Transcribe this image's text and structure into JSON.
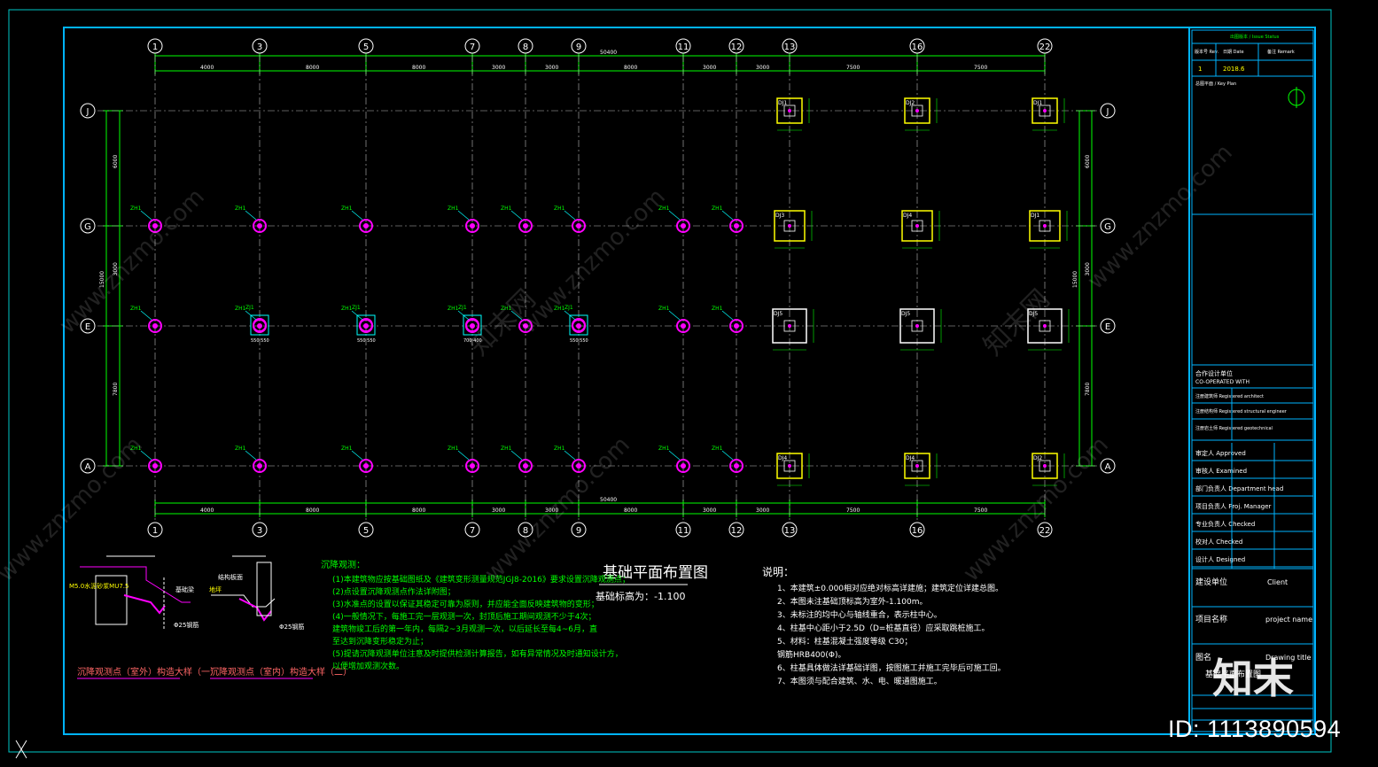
{
  "grid": {
    "vertical": [
      "1",
      "3",
      "5",
      "7",
      "8",
      "9",
      "11",
      "12",
      "13",
      "16",
      "22"
    ],
    "horizontal": [
      "J",
      "G",
      "E",
      "A"
    ]
  },
  "dimensions": {
    "top_spans": [
      "4000",
      "8000",
      "8000",
      "3000",
      "3000",
      "8000",
      "3000",
      "3000",
      "7500",
      "7500"
    ],
    "overall": "50400",
    "left_spans": [
      "6000",
      "3000",
      "7800"
    ],
    "left_total": "15000",
    "right_spans": [
      "6000",
      "3000",
      "7800"
    ],
    "right_total": "15000"
  },
  "piles": {
    "label": "ZH1"
  },
  "column_footings": {
    "labels": [
      "DJ1",
      "DJ2",
      "DJ1",
      "DJ3",
      "DJ4",
      "DJ1",
      "DJ5",
      "DJ5",
      "DJ5",
      "DJ4",
      "DJ4",
      "DJ2"
    ],
    "small_label": "ZJ1",
    "small_dims": [
      "550 550",
      "550 550",
      "700 400",
      "550 550"
    ]
  },
  "plan": {
    "title": "基础平面布置图",
    "subtitle": "基础标高为：-1.100"
  },
  "settlement": {
    "heading": "沉降观测：",
    "lines": [
      "(1)本建筑物应按基础图纸及《建筑变形测量规范JGJ8-2016》要求设置沉降观测点；",
      "(2)点设置沉降观测点作法详附图；",
      "(3)水准点的设置以保证其稳定可靠为原则，并应能全面反映建筑物的变形；",
      "(4)一般情况下，每施工完一层观测一次，封顶后施工期间观测不少于4次；",
      "    建筑物竣工后的第一年内，每隔2~3月观测一次，以后延长至每4~6月，直",
      "    至达到沉降变形稳定为止；",
      "(5)提请沉降观测单位注意及时提供检测计算报告，如有异常情况及时通知设计方，",
      "    以便增加观测次数。"
    ]
  },
  "notes": {
    "heading": "说明：",
    "lines": [
      "1、本建筑±0.000相对应绝对标高详建施；建筑定位详建总图。",
      "2、本图未注基础顶标高为室外-1.100m。",
      "3、未标注的均中心与轴线重合，表示柱中心。",
      "4、柱基中心距小于2.5D（D=桩基直径）应采取跳桩施工。",
      "5、材料：柱基混凝土强度等级 C30；",
      "    钢筋HRB400(Φ)。",
      "6、柱基具体做法详基础详图，按图施工并施工完毕后可施工回。",
      "7、本图须与配合建筑、水、电、暖通图施工。"
    ]
  },
  "details": [
    {
      "caption": "沉降观测点（室外）构造大样（一）",
      "labels": [
        "M5.0水泥砂浆MU7.5",
        "Φ25钢筋",
        "基础梁"
      ]
    },
    {
      "caption": "沉降观测点（室内）构造大样（二）",
      "labels": [
        "Φ25钢筋",
        "结构板面",
        "地坪"
      ]
    }
  ],
  "title_block": {
    "rev_header": "出图版本 / Issue Status",
    "rev_cols": [
      "版本号 Rev.",
      "日期 Date",
      "备注 Remark"
    ],
    "rev_row": [
      "1",
      "2018.6",
      ""
    ],
    "key_plan": "总图平面 / Key Plan",
    "cooperation": "合作设计单位",
    "co_operated": "CO-OPERATED WITH",
    "stamps": [
      "注册建筑师 Registered architect",
      "注册结构师 Registered structural engineer",
      "注册岩土师 Registered geotechnical"
    ],
    "roles": [
      "审定人 Approved",
      "审核人 Examined",
      "部门负责人 Department head",
      "项目负责人 Proj. Manager",
      "专业负责人 Checked",
      "校对人 Checked",
      "设计人 Designed"
    ],
    "client_label": "建设单位",
    "client_value": "Client",
    "project_label": "项目名称",
    "project_value": "project name",
    "drawing_label": "图名",
    "drawing_value": "Drawing title",
    "drawing_name": "基础平面布置图"
  },
  "watermark": "www.znzmo.com",
  "watermark_cn": "知末网",
  "logo": "知末",
  "id_badge": "ID: 1113890594",
  "colors": {
    "background": "#000000",
    "frame": "#00c8c8",
    "dimension": "#00ff00",
    "grid_axis": "#ffffff",
    "pile": "#ff00ff",
    "footing": "#ffff00",
    "text": "#ffffff",
    "notes_green": "#00ff00"
  }
}
